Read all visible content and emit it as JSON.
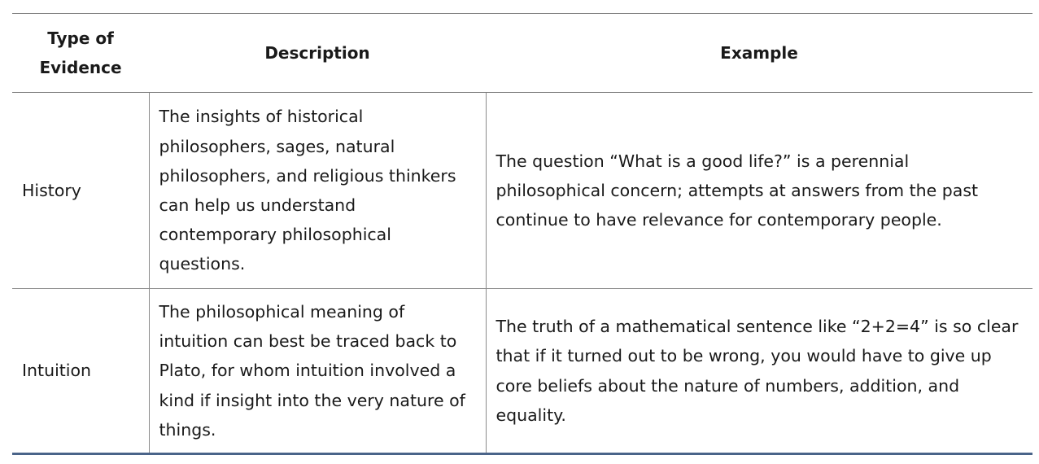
{
  "table": {
    "headers": [
      "Type of Evidence",
      "Description",
      "Example"
    ],
    "rows": [
      {
        "type": "History",
        "description": "The insights of historical philosophers, sages, natural philosophers, and religious thinkers can help us understand contemporary philosophical questions.",
        "example": "The question “What is a good life?” is a perennial philosophical concern; attempts at answers from the past continue to have relevance for contemporary people."
      },
      {
        "type": "Intuition",
        "description": "The philosophical meaning of intuition can best be traced back to Plato, for whom intuition involved a kind if insight into the very nature of things.",
        "example": "The truth of a mathematical sentence like “2+2=4” is so clear that if it turned out to be wrong, you would have to give up core beliefs about the nature of numbers, addition, and equality."
      }
    ]
  }
}
